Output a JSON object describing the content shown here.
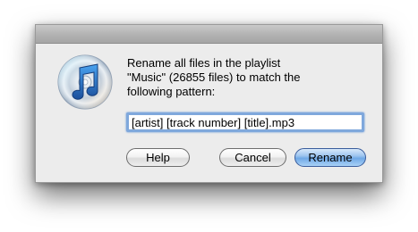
{
  "dialog": {
    "app_icon": "itunes-music-note-cd-icon",
    "message": "Rename  all files in the playlist\n\"Music\" (26855 files) to match the\nfollowing pattern:",
    "pattern_value": "[artist] [track number] [title].mp3",
    "buttons": {
      "help": "Help",
      "cancel": "Cancel",
      "rename": "Rename"
    }
  },
  "colors": {
    "dialog_background": "#ececec",
    "default_button": "#6fa8e6",
    "focus_ring": "#7fa8dc"
  }
}
